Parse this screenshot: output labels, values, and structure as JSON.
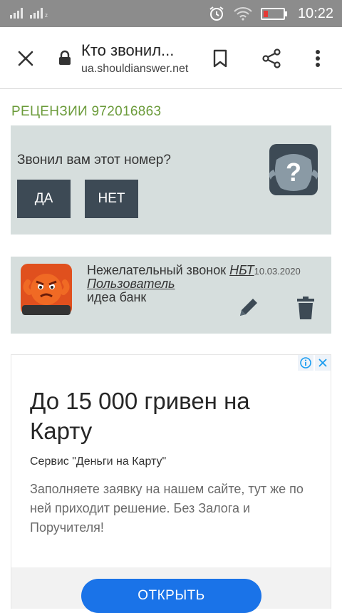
{
  "status_bar": {
    "time": "10:22",
    "colors": {
      "background": "#8c8c8c",
      "battery_low": "#e53935"
    }
  },
  "toolbar": {
    "title": "Кто звонил...",
    "url": "ua.shouldianswer.net",
    "icons": [
      "close-icon",
      "lock-icon",
      "bookmark-icon",
      "share-icon",
      "more-vert-icon"
    ]
  },
  "reviews": {
    "title": "РЕЦЕНЗИИ 972016863",
    "accent_color": "#6b9b3a"
  },
  "question_card": {
    "question": "Звонил вам этот номер?",
    "yes_label": "ДА",
    "no_label": "НЕТ",
    "button_color": "#3d4a55"
  },
  "review": {
    "category": "Нежелательный звонок",
    "operator": "НБТ",
    "date": "10.03.2020",
    "user": "Пользователь",
    "comment": "идеа банк"
  },
  "ad": {
    "headline": "До 15 000 гривен на Карту",
    "advertiser": "Сервис \"Деньги на Карту\"",
    "body": "Заполняете заявку на нашем сайте, тут же по ней приходит решение. Без Залога и Поручителя!",
    "cta_label": "ОТКРЫТЬ",
    "cta_color": "#1a73e8"
  }
}
